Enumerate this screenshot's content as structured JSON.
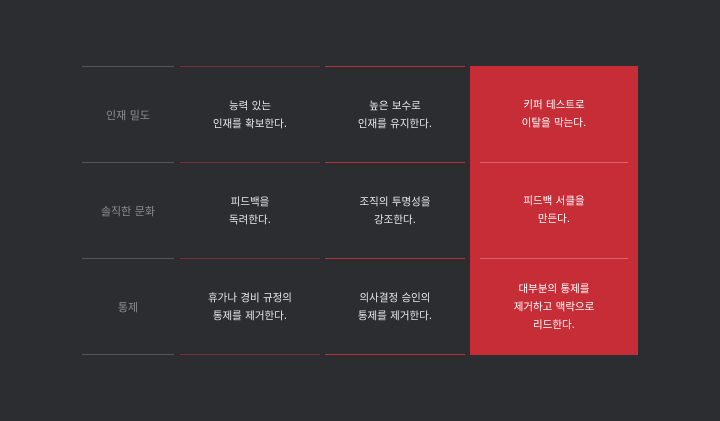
{
  "rows": [
    {
      "label": "인재 밀도",
      "col1": "능력 있는\n인재를 확보한다.",
      "col2": "높은 보수로\n인재를 유지한다.",
      "col3": "키퍼 테스트로\n이탈을 막는다."
    },
    {
      "label": "솔직한 문화",
      "col1": "피드백을\n독려한다.",
      "col2": "조직의 투명성을\n강조한다.",
      "col3": "피드백 서클을\n만든다."
    },
    {
      "label": "통제",
      "col1": "휴가나 경비 규정의\n통제를 제거한다.",
      "col2": "의사결정 승인의\n통제를 제거한다.",
      "col3": "대부분의 통제를\n제거하고 맥락으로\n리드한다."
    }
  ],
  "colors": {
    "background": "#2c2d31",
    "highlight": "#c62d36",
    "label_text": "#8b8c90",
    "cell_text": "#e6e6e8"
  }
}
